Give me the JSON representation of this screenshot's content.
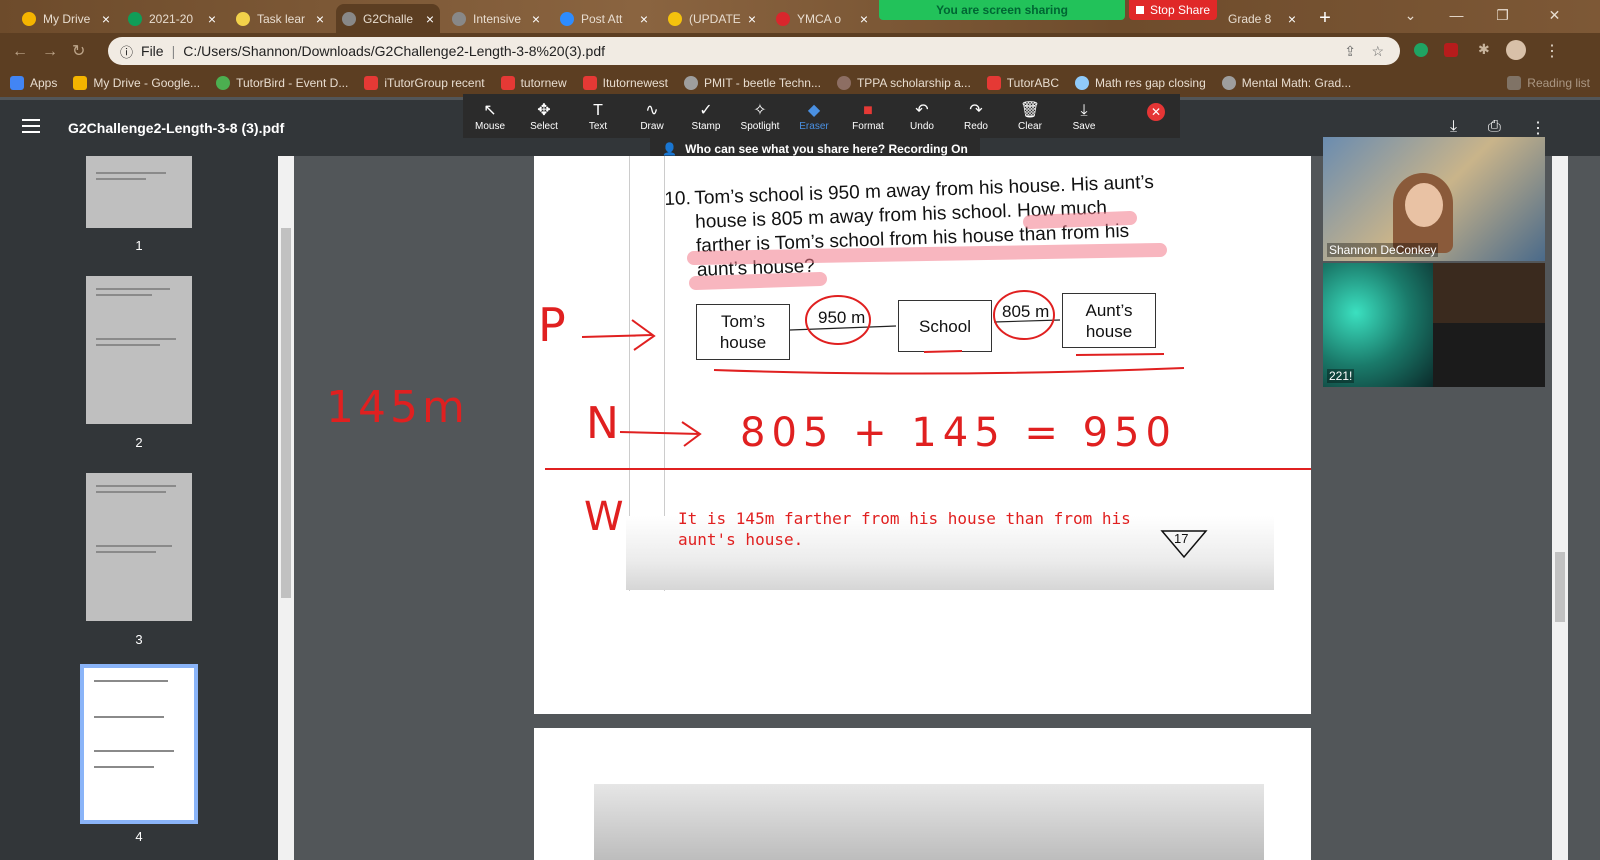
{
  "tabs": [
    {
      "title": "My Drive",
      "color": "#f4b400"
    },
    {
      "title": "2021-20",
      "color": "#0f9d58"
    },
    {
      "title": "Task lear",
      "color": "#f2d14a"
    },
    {
      "title": "G2Challe",
      "color": "#888888",
      "active": true
    },
    {
      "title": "Intensive",
      "color": "#888888"
    },
    {
      "title": "Post Att",
      "color": "#2d8cff"
    },
    {
      "title": "(UPDATE",
      "color": "#f4c20d"
    },
    {
      "title": "YMCA o",
      "color": "#d9262c"
    },
    {
      "title": "Grade 8",
      "color": "#888888"
    }
  ],
  "share": {
    "banner": "You are screen sharing",
    "stop": "Stop Share"
  },
  "address": {
    "label": "File",
    "url": "C:/Users/Shannon/Downloads/G2Challenge2-Length-3-8%20(3).pdf"
  },
  "bookmarks": [
    {
      "label": "Apps",
      "color": "#4285f4"
    },
    {
      "label": "My Drive - Google...",
      "color": "#f4b400"
    },
    {
      "label": "TutorBird - Event D...",
      "color": "#4caf50"
    },
    {
      "label": "iTutorGroup recent",
      "color": "#e53935"
    },
    {
      "label": "tutornew",
      "color": "#e53935"
    },
    {
      "label": "Itutornewest",
      "color": "#e53935"
    },
    {
      "label": "PMIT - beetle Techn...",
      "color": "#9e9e9e"
    },
    {
      "label": "TPPA scholarship a...",
      "color": "#8d6e63"
    },
    {
      "label": "TutorABC",
      "color": "#e53935"
    },
    {
      "label": "Math res gap closing",
      "color": "#90caf9"
    },
    {
      "label": "Mental Math: Grad...",
      "color": "#9e9e9e"
    },
    {
      "label": "Reading list",
      "color": "#9e9e9e"
    }
  ],
  "pdf": {
    "title": "G2Challenge2-Length-3-8 (3).pdf"
  },
  "zoom_tools": [
    {
      "label": "Mouse",
      "icon": "↖"
    },
    {
      "label": "Select",
      "icon": "✥"
    },
    {
      "label": "Text",
      "icon": "T"
    },
    {
      "label": "Draw",
      "icon": "∿"
    },
    {
      "label": "Stamp",
      "icon": "✓"
    },
    {
      "label": "Spotlight",
      "icon": "✧"
    },
    {
      "label": "Eraser",
      "icon": "◆"
    },
    {
      "label": "Format",
      "icon": "■"
    },
    {
      "label": "Undo",
      "icon": "↶"
    },
    {
      "label": "Redo",
      "icon": "↷"
    },
    {
      "label": "Clear",
      "icon": "🗑"
    },
    {
      "label": "Save",
      "icon": "⤓"
    }
  ],
  "recording": "Who can see what you share here? Recording On",
  "thumbs": [
    "1",
    "2",
    "3",
    "4"
  ],
  "question": {
    "number": "10.",
    "lines": [
      "Tom’s school is 950 m away from his house. His aunt’s",
      "house is 805 m away from his school. How much",
      "farther is Tom’s school from his house than from his",
      "aunt’s house?"
    ]
  },
  "diagram": {
    "box1": [
      "Tom’s",
      "house"
    ],
    "box2": "School",
    "box3": [
      "Aunt’s",
      "house"
    ],
    "d1": "950 m",
    "d2": "805 m"
  },
  "annot": {
    "p": "P",
    "n": "N",
    "w": "W",
    "side": "145m",
    "equation": "805 + 145 = 950"
  },
  "answer": "It is 145m farther from his house than from his aunt's house.",
  "page_number": "17",
  "participants": [
    {
      "name": "Shannon DeConkey"
    },
    {
      "name": "221!"
    }
  ]
}
